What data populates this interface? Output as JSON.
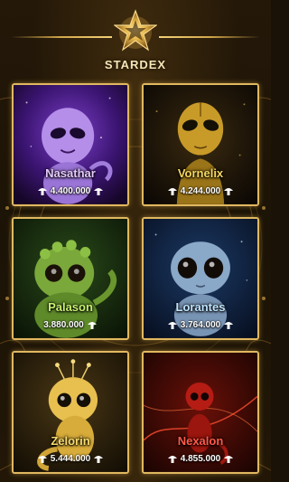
{
  "header": {
    "title": "STARDEX",
    "badge_icon": "star-icon"
  },
  "cards": [
    {
      "name": "Nasathar",
      "price": "4.400.000",
      "theme": "purple",
      "currency_icon": "mushroom-coin-icon"
    },
    {
      "name": "Vornelix",
      "price": "4.244.000",
      "theme": "gold",
      "currency_icon": "mushroom-coin-icon"
    },
    {
      "name": "Palason",
      "price": "3.880.000",
      "theme": "green",
      "currency_icon": "mushroom-coin-icon"
    },
    {
      "name": "Lorantes",
      "price": "3.764.000",
      "theme": "blue",
      "currency_icon": "mushroom-coin-icon"
    },
    {
      "name": "Zelorin",
      "price": "5.444.000",
      "theme": "yellow",
      "currency_icon": "mushroom-coin-icon"
    },
    {
      "name": "Nexalon",
      "price": "4.855.000",
      "theme": "red",
      "currency_icon": "mushroom-coin-icon"
    }
  ],
  "colors": {
    "frame_gold": "#e0b860",
    "background": "#1b1306"
  }
}
